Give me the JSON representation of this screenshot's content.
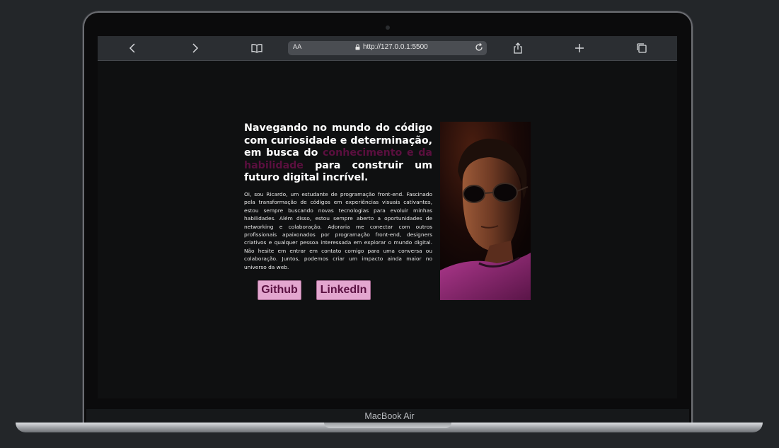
{
  "device": {
    "label": "MacBook Air"
  },
  "browser": {
    "address_small_text": "AA",
    "url": "http://127.0.0.1:5500",
    "icons": [
      "back-icon",
      "forward-icon",
      "bookmarks-icon",
      "lock-icon",
      "reload-icon",
      "share-icon",
      "new-tab-icon",
      "tabs-icon"
    ]
  },
  "page": {
    "headline_start": "Navegando no mundo do código com curiosidade e determinação, em busca do ",
    "headline_highlight": "conhecimento e da habilidade",
    "headline_end": " para construir um futuro digital incrível.",
    "bio": "Oi, sou Ricardo, um estudante de programação front-end. Fascinado pela transformação de códigos em experiências visuais cativantes, estou sempre buscando novas tecnologias para evoluir minhas habilidades. Além disso, estou sempre aberto a oportunidades de networking e colaboração. Adoraria me conectar com outros profissionais apaixonados por programação front-end, designers criativos e qualquer pessoa interessada em explorar o mundo digital. Não hesite em entrar em contato comigo para uma conversa ou colaboração. Juntos, podemos criar um impacto ainda maior no universo da web.",
    "buttons": {
      "github": "Github",
      "linkedin": "LinkedIn"
    },
    "colors": {
      "background": "#0f1011",
      "highlight_text": "#5a0f3e",
      "button_bg": "#e3a6cf",
      "button_text": "#5b1142"
    }
  }
}
